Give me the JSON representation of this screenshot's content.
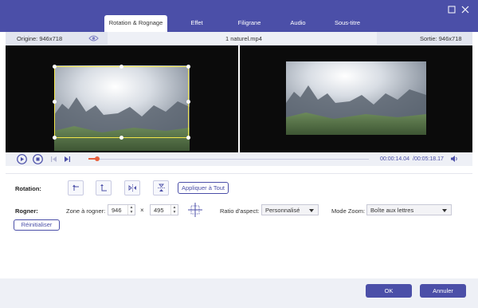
{
  "window": {
    "minimize_icon": "square-icon",
    "close_icon": "close-icon"
  },
  "tabs": [
    {
      "label": "Rotation & Rognage",
      "active": true
    },
    {
      "label": "Effet",
      "active": false
    },
    {
      "label": "Filigrane",
      "active": false
    },
    {
      "label": "Audio",
      "active": false
    },
    {
      "label": "Sous-titre",
      "active": false
    }
  ],
  "info": {
    "origin": "Origine: 946x718",
    "filename": "1 naturel.mp4",
    "output": "Sortie: 946x718"
  },
  "player": {
    "current_time": "00:00:14.04",
    "total_time": "/00:05:18.17",
    "progress": 0.03
  },
  "rotation": {
    "label": "Rotation:",
    "apply_all": "Appliquer à Tout"
  },
  "crop": {
    "label": "Rogner:",
    "zone_label": "Zone à rogner:",
    "width": "946",
    "times": "×",
    "height": "495",
    "aspect_label": "Ratio d'aspect:",
    "aspect_value": "Personnalisé",
    "zoom_label": "Mode Zoom:",
    "zoom_value": "Boîte aux lettres",
    "reset": "Réinitialiser"
  },
  "footer": {
    "ok": "OK",
    "cancel": "Annuler"
  },
  "colors": {
    "accent": "#4b4fa8",
    "progress": "#e8603c",
    "crop_frame": "#f2e64a"
  }
}
